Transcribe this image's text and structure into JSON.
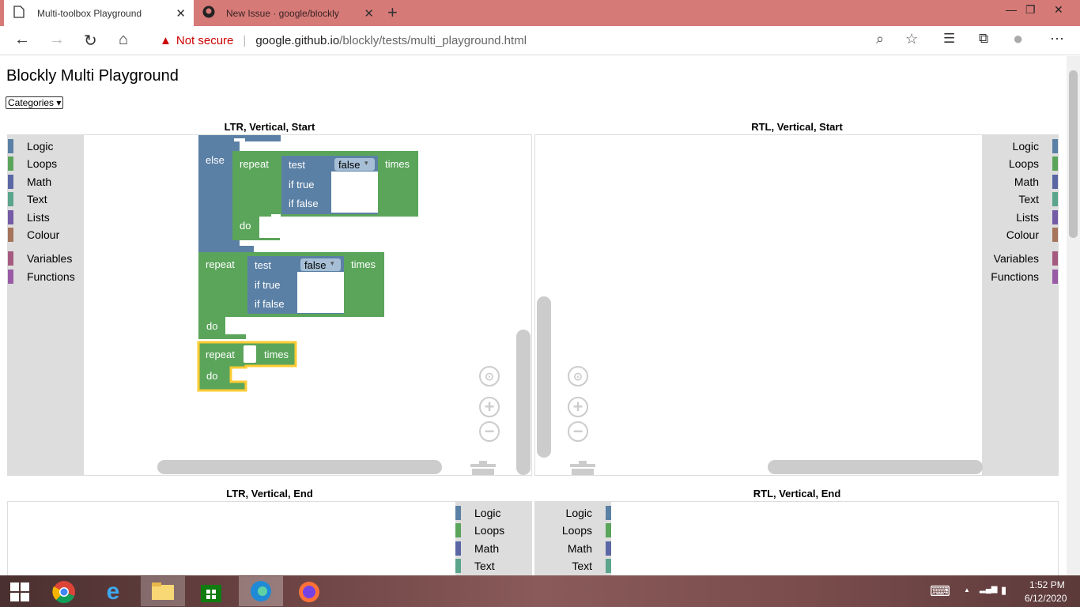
{
  "browser": {
    "tabs": [
      {
        "title": "Multi-toolbox Playground",
        "close": "✕"
      },
      {
        "title": "New Issue · google/blockly",
        "close": "✕"
      }
    ],
    "new_tab": "+",
    "controls": {
      "minimize": "—",
      "restore": "❐",
      "close": "✕"
    },
    "nav": {
      "back": "←",
      "forward": "→",
      "reload": "↻",
      "home": "⌂"
    },
    "address": {
      "warning_icon": "▲",
      "not_secure": "Not secure",
      "separator": "|",
      "host": "google.github.io",
      "path": "/blockly/tests/multi_playground.html"
    },
    "toolbar_icons": {
      "zoom": "⌕",
      "favorite": "☆",
      "favorites": "☰",
      "collections": "⧉",
      "profile": "●",
      "more": "⋯"
    }
  },
  "page": {
    "title": "Blockly Multi Playground",
    "select_value": "Categories"
  },
  "categories": [
    {
      "label": "Logic",
      "color": "#5b80a5"
    },
    {
      "label": "Loops",
      "color": "#5ba55b"
    },
    {
      "label": "Math",
      "color": "#5b67a5"
    },
    {
      "label": "Text",
      "color": "#5ba58c"
    },
    {
      "label": "Lists",
      "color": "#745ba5"
    },
    {
      "label": "Colour",
      "color": "#a5745b"
    },
    {
      "label": "Variables",
      "color": "#a55b80"
    },
    {
      "label": "Functions",
      "color": "#995ba5"
    }
  ],
  "workspaces": {
    "ltr_start": {
      "label": "LTR, Vertical, Start"
    },
    "rtl_start": {
      "label": "RTL, Vertical, Start"
    },
    "ltr_end": {
      "label": "LTR, Vertical, End"
    },
    "rtl_end": {
      "label": "RTL, Vertical, End"
    }
  },
  "blocks": {
    "else": "else",
    "repeat": "repeat",
    "times": "times",
    "do": "do",
    "test": "test",
    "if_true": "if true",
    "if_false": "if false",
    "false_value": "false",
    "dropdown_arrow": "▾"
  },
  "ws_controls": {
    "recenter": "⊙",
    "zoom_in": "+",
    "zoom_out": "−"
  },
  "taskbar": {
    "time": "1:52 PM",
    "date": "6/12/2020",
    "keyboard": "⌨",
    "tray_up": "▲",
    "network": "▂▄▆",
    "battery": "▮"
  },
  "colors": {
    "logic": "#5b80a5",
    "loops": "#5ba55b",
    "selected": "#fc3"
  }
}
